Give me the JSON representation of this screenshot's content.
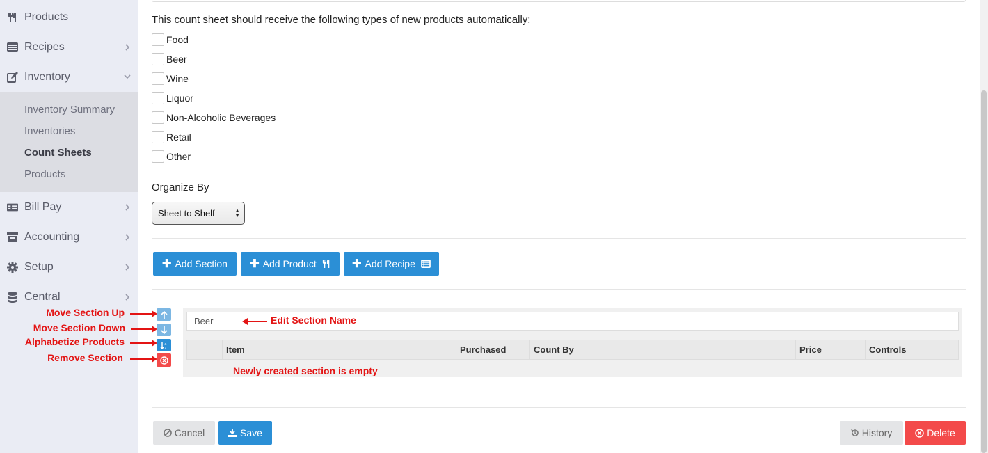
{
  "sidebar": {
    "items": [
      {
        "label": "Products",
        "icon": "utensils-icon"
      },
      {
        "label": "Recipes",
        "icon": "list-icon"
      },
      {
        "label": "Inventory",
        "icon": "edit-icon"
      },
      {
        "label": "Bill Pay",
        "icon": "money-bill-icon"
      },
      {
        "label": "Accounting",
        "icon": "archive-icon"
      },
      {
        "label": "Setup",
        "icon": "gear-icon"
      },
      {
        "label": "Central",
        "icon": "database-icon"
      }
    ],
    "inventory_sub": [
      "Inventory Summary",
      "Inventories",
      "Count Sheets",
      "Products"
    ],
    "active_sub": "Count Sheets"
  },
  "form": {
    "receive_heading": "This count sheet should receive the following types of new products automatically:",
    "product_types": [
      "Food",
      "Beer",
      "Wine",
      "Liquor",
      "Non-Alcoholic Beverages",
      "Retail",
      "Other"
    ],
    "organize_label": "Organize By",
    "organize_value": "Sheet to Shelf"
  },
  "actions": {
    "add_section": "Add Section",
    "add_product": "Add Product",
    "add_recipe": "Add Recipe"
  },
  "section": {
    "name_value": "Beer",
    "columns": [
      "Item",
      "Purchased",
      "Count By",
      "Price",
      "Controls"
    ]
  },
  "annotations": {
    "move_up": "Move Section Up",
    "move_down": "Move Section Down",
    "alphabetize": "Alphabetize Products",
    "remove": "Remove Section",
    "edit_name": "Edit Section Name",
    "empty_note": "Newly created section is empty"
  },
  "footer": {
    "cancel": "Cancel",
    "save": "Save",
    "history": "History",
    "delete": "Delete"
  },
  "colors": {
    "primary": "#2b8fd6",
    "danger": "#f34a4a",
    "annotation": "#e31414",
    "sidebar_bg": "#eaecf4"
  }
}
